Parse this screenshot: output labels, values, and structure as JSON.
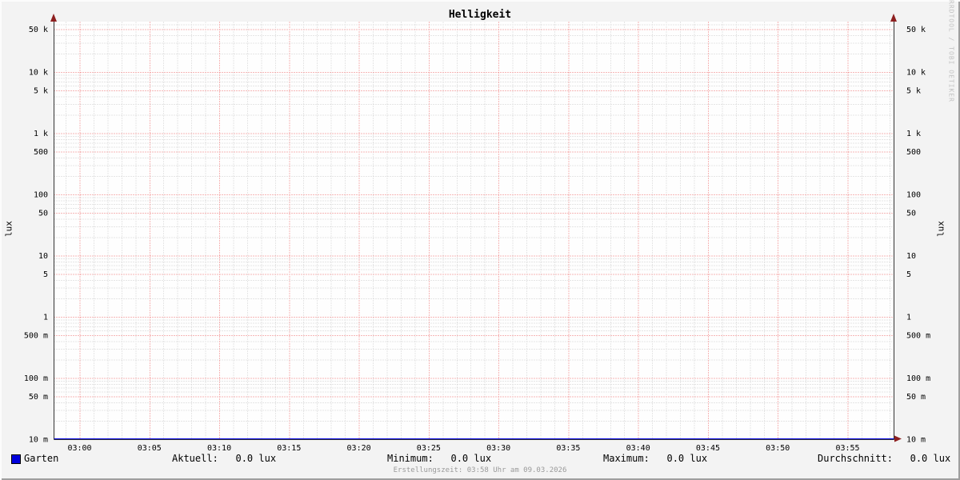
{
  "watermark": "RRDTOOL / TOBI OETIKER",
  "footer": "Erstellungszeit: 03:58 Uhr am 09.03.2026",
  "legend": {
    "items": [
      {
        "label": "Garten",
        "color": "#0000dd"
      }
    ],
    "stats": [
      "Aktuell:   0.0 lux",
      "Minimum:   0.0 lux",
      "Maximum:   0.0 lux",
      "Durchschnitt:   0.0 lux"
    ]
  },
  "chart_data": {
    "type": "line",
    "title": "Helligkeit",
    "ylabel": "lux",
    "y_scale": "log",
    "ylim": [
      0.01,
      66000
    ],
    "x_range_time": [
      "02:58",
      "03:58"
    ],
    "x_major_step_min": 5,
    "x_minor_step_min": 1,
    "grid": {
      "minor_color": "#cfcfcf",
      "major_color": "#f07070",
      "on": true
    },
    "axis_color": "#333333",
    "arrow_color": "#8d1f1f",
    "x_ticks": [
      "03:00",
      "03:05",
      "03:10",
      "03:15",
      "03:20",
      "03:25",
      "03:30",
      "03:35",
      "03:40",
      "03:45",
      "03:50",
      "03:55"
    ],
    "y_ticks": [
      {
        "label": "50 k",
        "value": 50000
      },
      {
        "label": "10 k",
        "value": 10000
      },
      {
        "label": "5 k",
        "value": 5000
      },
      {
        "label": "1 k",
        "value": 1000
      },
      {
        "label": "500",
        "value": 500
      },
      {
        "label": "100",
        "value": 100
      },
      {
        "label": "50",
        "value": 50
      },
      {
        "label": "10",
        "value": 10
      },
      {
        "label": "5",
        "value": 5
      },
      {
        "label": "1",
        "value": 1
      },
      {
        "label": "500 m",
        "value": 0.5
      },
      {
        "label": "100 m",
        "value": 0.1
      },
      {
        "label": "50 m",
        "value": 0.05
      },
      {
        "label": "10 m",
        "value": 0.01
      }
    ],
    "series": [
      {
        "name": "Garten",
        "color": "#0000dd",
        "value_constant_lux": 0.0,
        "stats": {
          "aktuell": 0.0,
          "minimum": 0.0,
          "maximum": 0.0,
          "durchschnitt": 0.0,
          "unit": "lux"
        }
      }
    ]
  }
}
